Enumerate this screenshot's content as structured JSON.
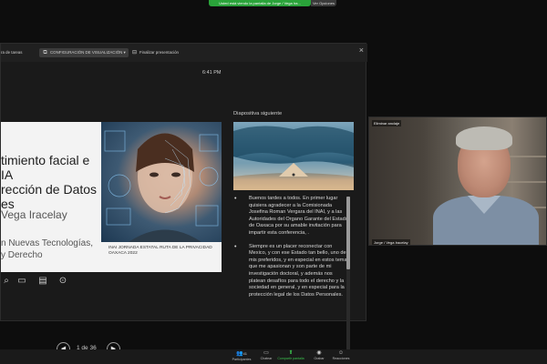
{
  "share_banner": {
    "text": "Usted está viendo la pantalla de Jorge / Vega Ira...",
    "options_label": "Ver Opciones"
  },
  "presenter": {
    "toolbar": {
      "tasks_label": "ra de tareas",
      "config_label": "CONFIGURACIÓN DE VISUALIZACIÓN",
      "end_label": "Finalizar presentación"
    },
    "time": "6:41 PM",
    "slide": {
      "title": "timiento facial e IA\nrección de Datos\nes",
      "author": "Vega Iracelay",
      "affiliation": "n Nuevas Tecnologías,\ny Derecho",
      "caption": "INAI JORNADA ESTATAL RUTA DE LA PRIVACIDAD\nOAXACA 2022"
    },
    "counter": "1 de 36",
    "next_slide_label": "Diapositiva siguiente",
    "notes": [
      "Buenos tardes a todos. En primer lugar quisiera agradecer a la Comisionada Josefina Roman Vergara del INAI, y a las Autoridades del Organo Garante del Estado de Oaxaca por su amable invitación para impartir esta conferencia, .",
      "Siempre es un placer reconectar con Mexico, y con ese Estado tan bello, uno de mis preferidos, y en especial en estos temas que me apasionan y son parte de mi investigación doctoral, y además nos platean desafíos para todo el derecho y la sociedad en general, y en especial para la protección legal de los Datos Personales."
    ],
    "font_controls": [
      "A",
      "A"
    ]
  },
  "video": {
    "menu_label": "Eliminar anclaje",
    "name_label": "Jorge / Vega Iracelay"
  },
  "bottom_bar": [
    {
      "label": "Participantes",
      "count": "41",
      "icon": "participants-icon"
    },
    {
      "label": "Chatear",
      "icon": "chat-icon"
    },
    {
      "label": "Compartir pantalla",
      "icon": "share-icon"
    },
    {
      "label": "Grabar",
      "icon": "record-icon"
    },
    {
      "label": "Reacciones",
      "icon": "reactions-icon"
    }
  ],
  "colors": {
    "share_green": "#2aa33a",
    "accent_green": "#3cc24e",
    "background": "#0d0d0d"
  }
}
